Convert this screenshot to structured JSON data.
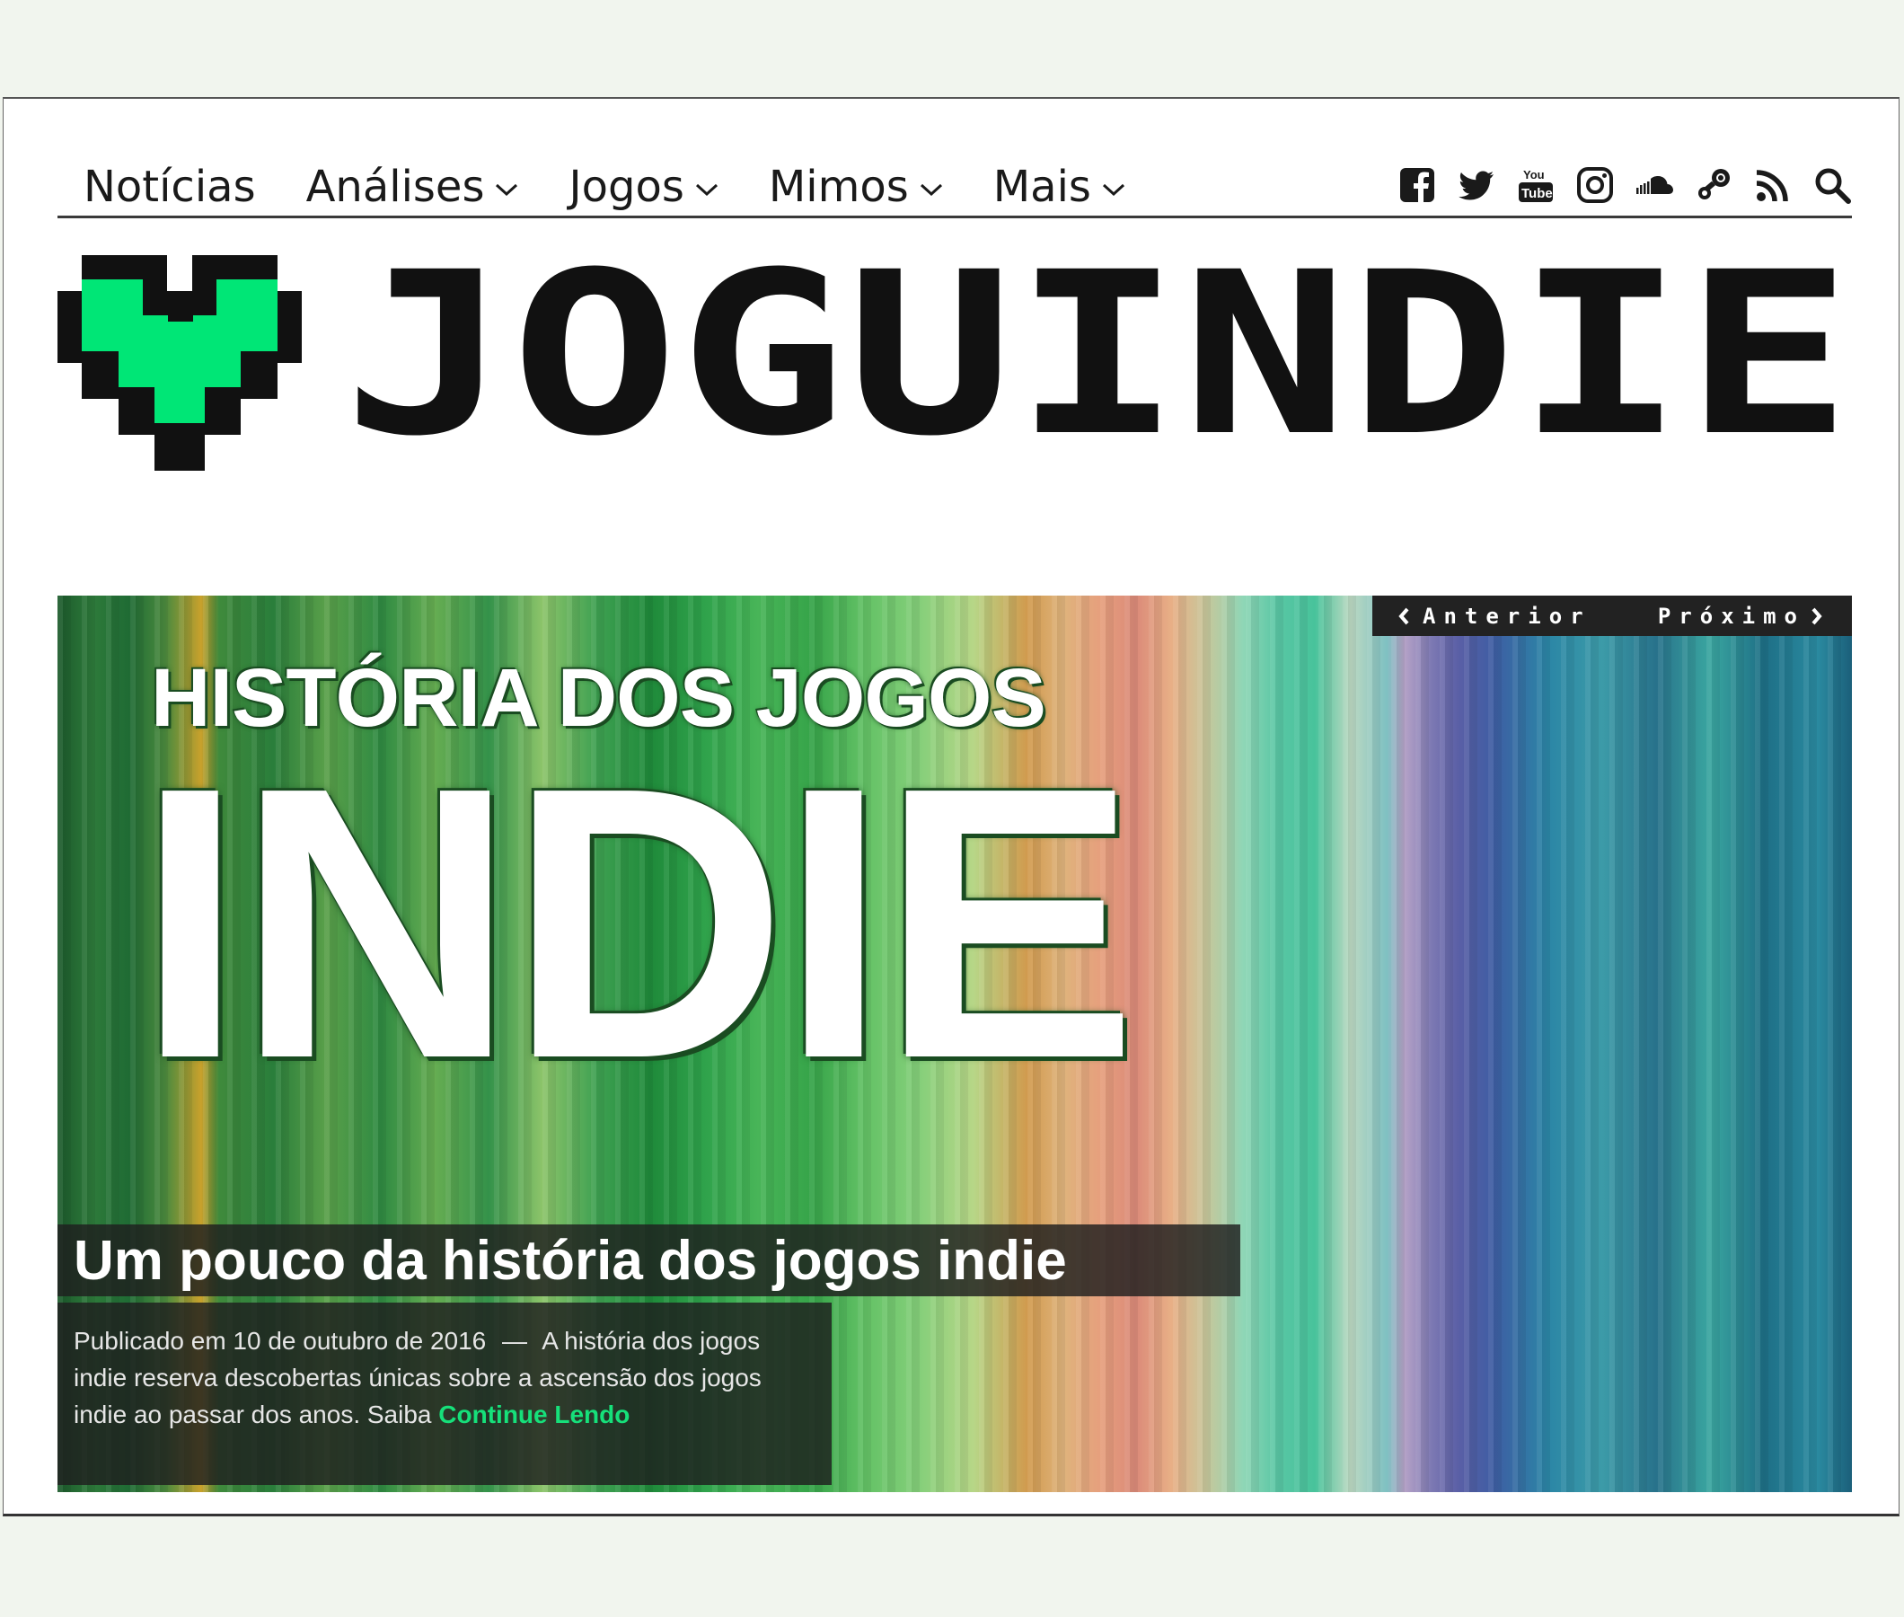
{
  "nav": {
    "items": [
      {
        "label": "Notícias",
        "dropdown": false
      },
      {
        "label": "Análises",
        "dropdown": true
      },
      {
        "label": "Jogos",
        "dropdown": true
      },
      {
        "label": "Mimos",
        "dropdown": true
      },
      {
        "label": "Mais",
        "dropdown": true
      }
    ],
    "social_icons": [
      "facebook-icon",
      "twitter-icon",
      "youtube-icon",
      "instagram-icon",
      "soundcloud-icon",
      "steam-icon",
      "rss-icon",
      "search-icon"
    ]
  },
  "logo": {
    "text": "JOGUINDIE",
    "heart_color": "#00e676",
    "text_color": "#111111"
  },
  "hero": {
    "art_line1": "HISTÓRIA DOS JOGOS",
    "art_line2": "INDIE",
    "prev_label": "Anterior",
    "next_label": "Próximo",
    "headline": "Um pouco da história dos jogos indie",
    "excerpt": {
      "published": "Publicado em 10 de outubro de 2016",
      "separator": "—",
      "text": "A história dos jogos indie reserva descobertas únicas sobre a ascensão dos jogos indie ao passar dos anos. Saiba",
      "more": "Continue Lendo"
    },
    "accent_color": "#16e07a"
  }
}
